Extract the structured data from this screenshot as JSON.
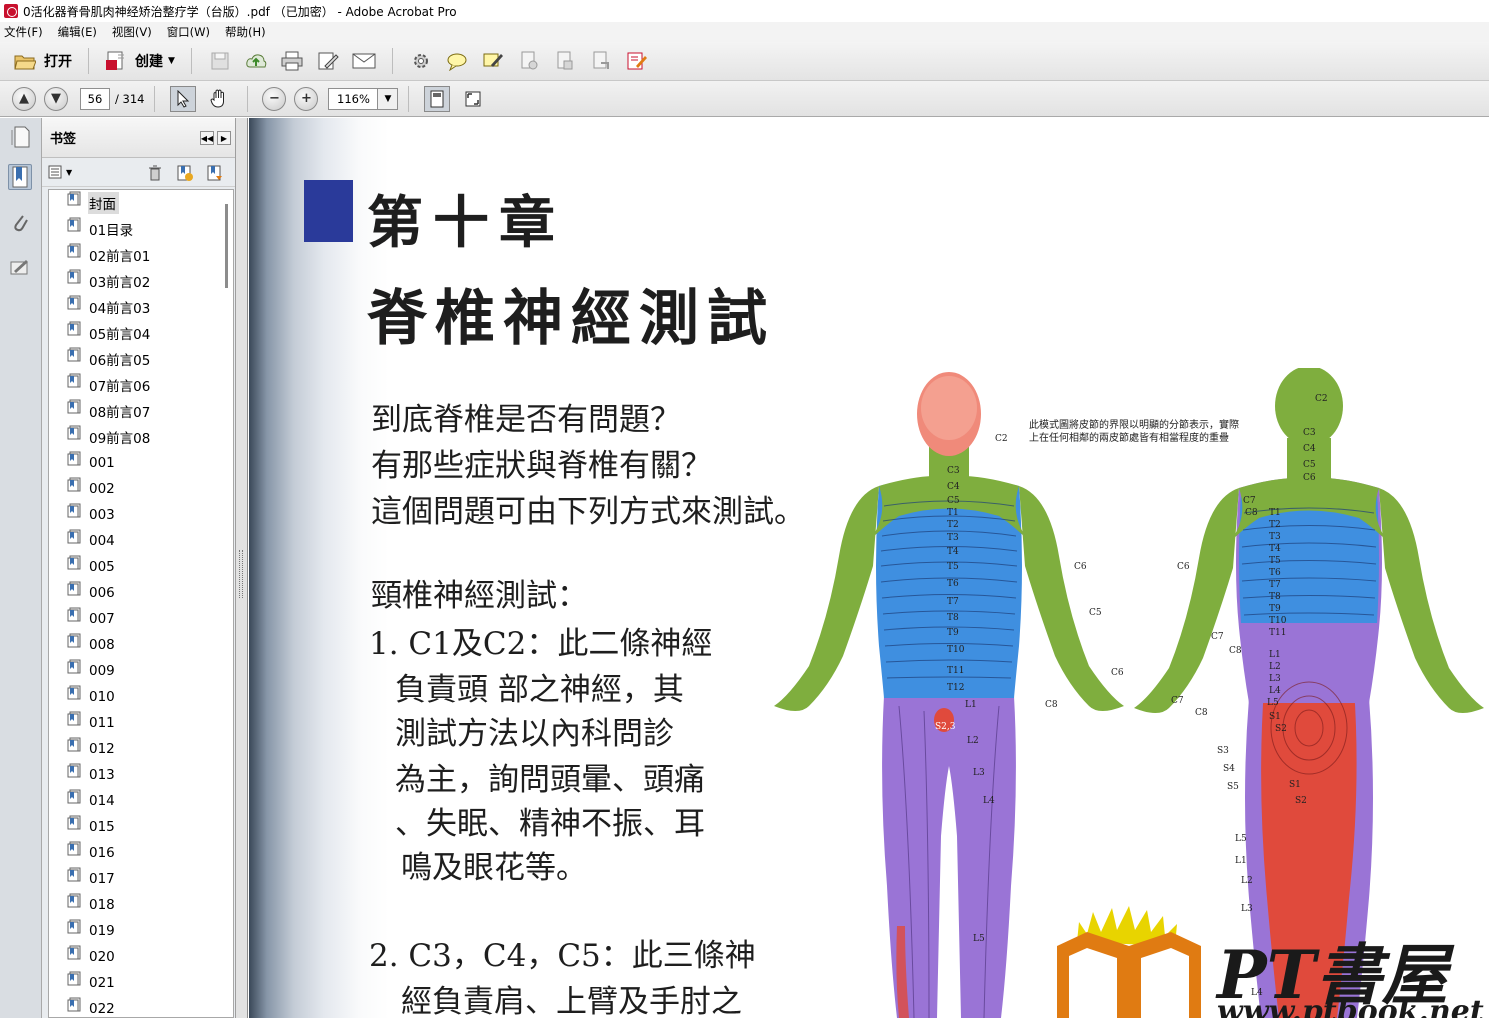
{
  "window": {
    "title": "0活化器脊骨肌肉神经矫治整疗学（台版）.pdf （已加密） - Adobe Acrobat Pro"
  },
  "menu": [
    "文件(F)",
    "编辑(E)",
    "视图(V)",
    "窗口(W)",
    "帮助(H)"
  ],
  "toolbar": {
    "open_label": "打开",
    "create_label": "创建",
    "icons": [
      "save-icon",
      "upload-icon",
      "print-icon",
      "edit-icon",
      "email-icon",
      "settings-icon",
      "comment-icon",
      "sign-icon",
      "doc-action-icon-1",
      "doc-action-icon-2",
      "doc-action-icon-3",
      "form-edit-icon"
    ]
  },
  "navigation": {
    "current_page": "56",
    "total_pages": "/ 314",
    "zoom": "116%"
  },
  "bookmarks": {
    "title": "书签",
    "items": [
      "封面",
      "01目录",
      "02前言01",
      "03前言02",
      "04前言03",
      "05前言04",
      "06前言05",
      "07前言06",
      "08前言07",
      "09前言08",
      "001",
      "002",
      "003",
      "004",
      "005",
      "006",
      "007",
      "008",
      "009",
      "010",
      "011",
      "012",
      "013",
      "014",
      "015",
      "016",
      "017",
      "018",
      "019",
      "020",
      "021",
      "022"
    ],
    "selected_index": 0
  },
  "document": {
    "chapter": "第十章",
    "title": "脊椎神經測試",
    "intro": [
      "到底脊椎是否有問題？",
      "有那些症狀與脊椎有關？",
      "這個問題可由下列方式來測試。"
    ],
    "section": "頸椎神經測試：",
    "item1": [
      "1. C1及C2：此二條神經",
      "負責頭 部之神經，其",
      "測試方法以內科問診",
      "為主，詢問頭暈、頭痛",
      "、失眠、精神不振、耳",
      "鳴及眼花等。"
    ],
    "item2": [
      "2. C3，C4，C5：此三條神",
      "經負責肩、上臂及手肘之"
    ],
    "figure_note": [
      "此模式圖將皮節的界限以明顯的分節表示，實際",
      "上在任何相鄰的兩皮節處皆有相當程度的重疊"
    ],
    "front_labels": {
      "head": "C2",
      "neck": [
        "C3",
        "C4",
        "C5"
      ],
      "thoracic": [
        "T1",
        "T2",
        "T3",
        "T4",
        "T5",
        "T6",
        "T7",
        "T8",
        "T9",
        "T10",
        "T11",
        "T12"
      ],
      "lumbar": [
        "L1",
        "L2",
        "L3",
        "L4",
        "L5"
      ],
      "sacral": "S2,3",
      "arm": [
        "C6",
        "C5",
        "C6",
        "C8"
      ]
    },
    "back_labels": {
      "neck": [
        "C2",
        "C3",
        "C4",
        "C5",
        "C6"
      ],
      "thoracic": [
        "T1",
        "T2",
        "T3",
        "T4",
        "T5",
        "T6",
        "T7",
        "T8",
        "T9",
        "T10",
        "T11"
      ],
      "arm": [
        "C6",
        "C7",
        "C8",
        "C7",
        "C8",
        "C7",
        "C8"
      ],
      "lower": [
        "L1",
        "L2",
        "L3",
        "L4",
        "L5",
        "S1",
        "S2",
        "S3",
        "S4",
        "S5",
        "S1",
        "S2",
        "L5",
        "L1",
        "L2",
        "L3",
        "L4"
      ]
    },
    "watermark": {
      "brand": "PT書屋",
      "url": "www.ptbook.net"
    }
  },
  "colors": {
    "chapter_mark": "#2a3a9a",
    "skin_green": "#7fae3e",
    "skin_blue": "#3f8fe0",
    "skin_purple": "#9a74d6",
    "skin_red": "#e04a3c",
    "logo_yellow": "#e8d400",
    "logo_orange": "#e07b12"
  }
}
